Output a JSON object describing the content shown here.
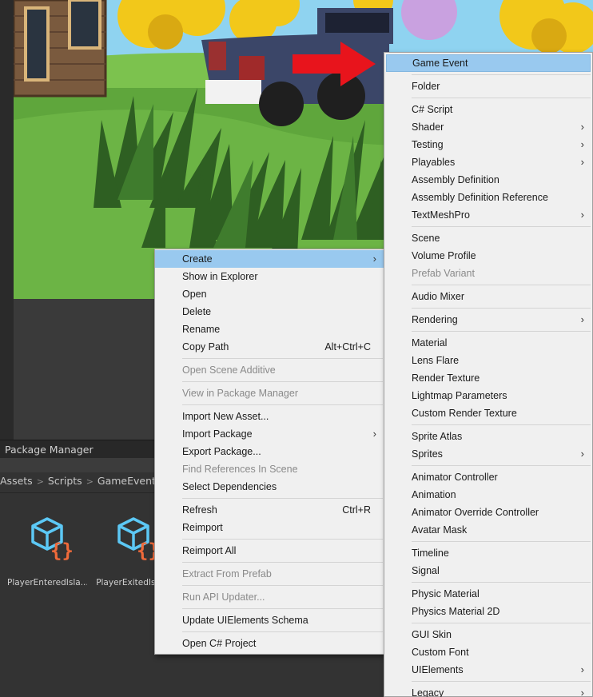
{
  "panel": {
    "tab_label": "Package Manager",
    "breadcrumb": [
      "Assets",
      "Scripts",
      "GameEvents S"
    ]
  },
  "assets": [
    {
      "label": "PlayerEnteredIsla...",
      "icon": "script-object-icon"
    },
    {
      "label": "PlayerExitedIsla...",
      "icon": "script-object-icon"
    }
  ],
  "context_menu": {
    "items": [
      {
        "type": "item",
        "label": "Create",
        "submenu": true,
        "highlighted": true
      },
      {
        "type": "item",
        "label": "Show in Explorer"
      },
      {
        "type": "item",
        "label": "Open"
      },
      {
        "type": "item",
        "label": "Delete"
      },
      {
        "type": "item",
        "label": "Rename"
      },
      {
        "type": "item",
        "label": "Copy Path",
        "shortcut": "Alt+Ctrl+C"
      },
      {
        "type": "sep"
      },
      {
        "type": "item",
        "label": "Open Scene Additive",
        "disabled": true
      },
      {
        "type": "sep"
      },
      {
        "type": "item",
        "label": "View in Package Manager",
        "disabled": true
      },
      {
        "type": "sep"
      },
      {
        "type": "item",
        "label": "Import New Asset..."
      },
      {
        "type": "item",
        "label": "Import Package",
        "submenu": true
      },
      {
        "type": "item",
        "label": "Export Package..."
      },
      {
        "type": "item",
        "label": "Find References In Scene",
        "disabled": true
      },
      {
        "type": "item",
        "label": "Select Dependencies"
      },
      {
        "type": "sep"
      },
      {
        "type": "item",
        "label": "Refresh",
        "shortcut": "Ctrl+R"
      },
      {
        "type": "item",
        "label": "Reimport"
      },
      {
        "type": "sep"
      },
      {
        "type": "item",
        "label": "Reimport All"
      },
      {
        "type": "sep"
      },
      {
        "type": "item",
        "label": "Extract From Prefab",
        "disabled": true
      },
      {
        "type": "sep"
      },
      {
        "type": "item",
        "label": "Run API Updater...",
        "disabled": true
      },
      {
        "type": "sep"
      },
      {
        "type": "item",
        "label": "Update UIElements Schema"
      },
      {
        "type": "sep"
      },
      {
        "type": "item",
        "label": "Open C# Project"
      }
    ]
  },
  "create_menu": {
    "items": [
      {
        "type": "item",
        "label": "Game Event",
        "highlighted": true
      },
      {
        "type": "sep"
      },
      {
        "type": "item",
        "label": "Folder"
      },
      {
        "type": "sep"
      },
      {
        "type": "item",
        "label": "C# Script"
      },
      {
        "type": "item",
        "label": "Shader",
        "submenu": true
      },
      {
        "type": "item",
        "label": "Testing",
        "submenu": true
      },
      {
        "type": "item",
        "label": "Playables",
        "submenu": true
      },
      {
        "type": "item",
        "label": "Assembly Definition"
      },
      {
        "type": "item",
        "label": "Assembly Definition Reference"
      },
      {
        "type": "item",
        "label": "TextMeshPro",
        "submenu": true
      },
      {
        "type": "sep"
      },
      {
        "type": "item",
        "label": "Scene"
      },
      {
        "type": "item",
        "label": "Volume Profile"
      },
      {
        "type": "item",
        "label": "Prefab Variant",
        "disabled": true
      },
      {
        "type": "sep"
      },
      {
        "type": "item",
        "label": "Audio Mixer"
      },
      {
        "type": "sep"
      },
      {
        "type": "item",
        "label": "Rendering",
        "submenu": true
      },
      {
        "type": "sep"
      },
      {
        "type": "item",
        "label": "Material"
      },
      {
        "type": "item",
        "label": "Lens Flare"
      },
      {
        "type": "item",
        "label": "Render Texture"
      },
      {
        "type": "item",
        "label": "Lightmap Parameters"
      },
      {
        "type": "item",
        "label": "Custom Render Texture"
      },
      {
        "type": "sep"
      },
      {
        "type": "item",
        "label": "Sprite Atlas"
      },
      {
        "type": "item",
        "label": "Sprites",
        "submenu": true
      },
      {
        "type": "sep"
      },
      {
        "type": "item",
        "label": "Animator Controller"
      },
      {
        "type": "item",
        "label": "Animation"
      },
      {
        "type": "item",
        "label": "Animator Override Controller"
      },
      {
        "type": "item",
        "label": "Avatar Mask"
      },
      {
        "type": "sep"
      },
      {
        "type": "item",
        "label": "Timeline"
      },
      {
        "type": "item",
        "label": "Signal"
      },
      {
        "type": "sep"
      },
      {
        "type": "item",
        "label": "Physic Material"
      },
      {
        "type": "item",
        "label": "Physics Material 2D"
      },
      {
        "type": "sep"
      },
      {
        "type": "item",
        "label": "GUI Skin"
      },
      {
        "type": "item",
        "label": "Custom Font"
      },
      {
        "type": "item",
        "label": "UIElements",
        "submenu": true
      },
      {
        "type": "sep"
      },
      {
        "type": "item",
        "label": "Legacy",
        "submenu": true
      }
    ]
  },
  "colors": {
    "menu_highlight": "#99c9ef",
    "asset_icon_blue": "#5cc8f5",
    "asset_icon_orange": "#f06a3a",
    "annotation_arrow": "#e8141c"
  }
}
